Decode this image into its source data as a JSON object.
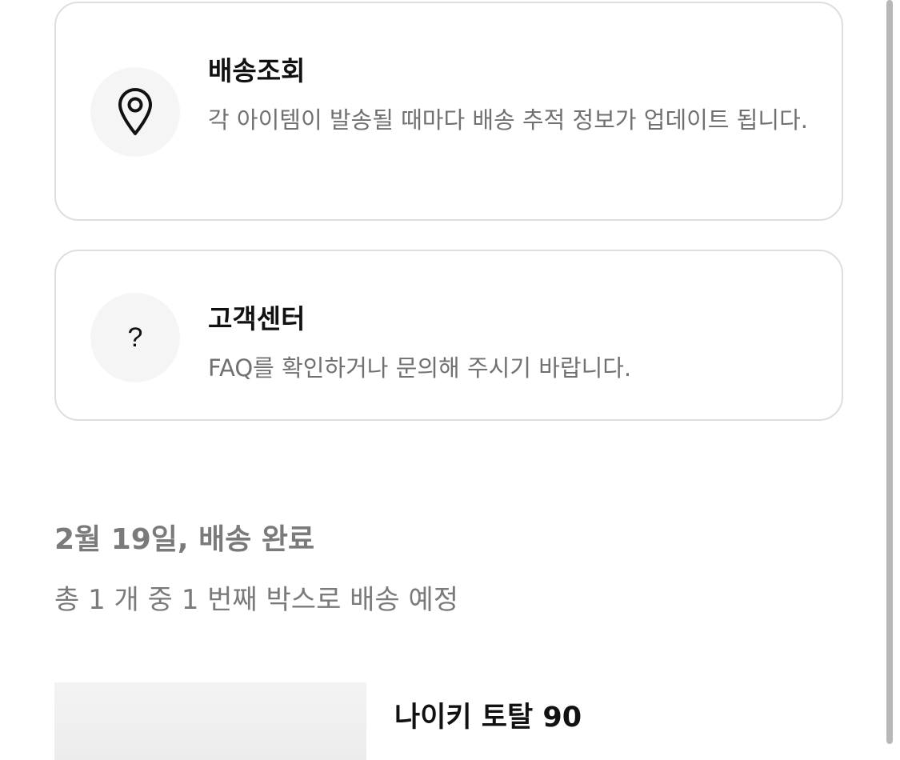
{
  "tracking_card": {
    "icon": "location-pin-icon",
    "title": "배송조회",
    "description": "각 아이템이 발송될 때마다 배송 추적 정보가 업데이트 됩니다."
  },
  "support_card": {
    "icon": "question-mark-icon",
    "icon_glyph": "?",
    "title": "고객센터",
    "description": "FAQ를 확인하거나 문의해 주시기 바랍니다."
  },
  "delivery_status": {
    "date_line": "2월 19일, 배송 완료",
    "box_line": "총 1 개 중 1 번째 박스로 배송 예정"
  },
  "product": {
    "name": "나이키 토탈 90"
  }
}
